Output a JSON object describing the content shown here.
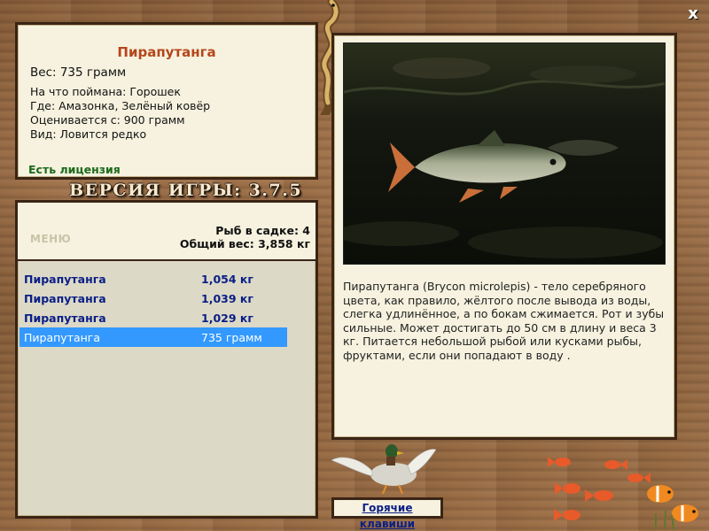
{
  "info": {
    "title": "Пирапутанга",
    "weight": "Вес: 735 грамм",
    "bait": "На что поймана: Горошек",
    "location": "Где: Амазонка, Зелёный ковёр",
    "valued_from": "Оценивается с: 900 грамм",
    "kind": "Вид: Ловится редко",
    "license": "Есть лицензия"
  },
  "version": "ВЕРСИЯ ИГРЫ: 3.7.5",
  "keeper": {
    "menu_label": "МЕНЮ",
    "count": "Рыб в садке: 4",
    "total_weight": "Общий вес: 3,858 кг",
    "items": [
      {
        "name": "Пирапутанга",
        "weight": "1,054 кг"
      },
      {
        "name": "Пирапутанга",
        "weight": "1,039 кг"
      },
      {
        "name": "Пирапутанга",
        "weight": "1,029 кг"
      },
      {
        "name": "Пирапутанга",
        "weight": "735 грамм"
      }
    ]
  },
  "description": "Пирапутанга (Brycon microlepis) - тело серебряного цвета, как правило, жёлтого после вывода из воды, слегка удлинённое, а по бокам сжимается. Рот и зубы сильные. Может достигать до 50 см в длину и веса 3 кг. Питается небольшой рыбой или кусками рыбы, фруктами, если они попадают в воду .",
  "hotkeys_label": "Горячие клавиши",
  "close_label": "x",
  "colors": {
    "title": "#b5461b",
    "license": "#1c6a1c",
    "list_text": "#0a1f87",
    "selection": "#3399ff"
  }
}
